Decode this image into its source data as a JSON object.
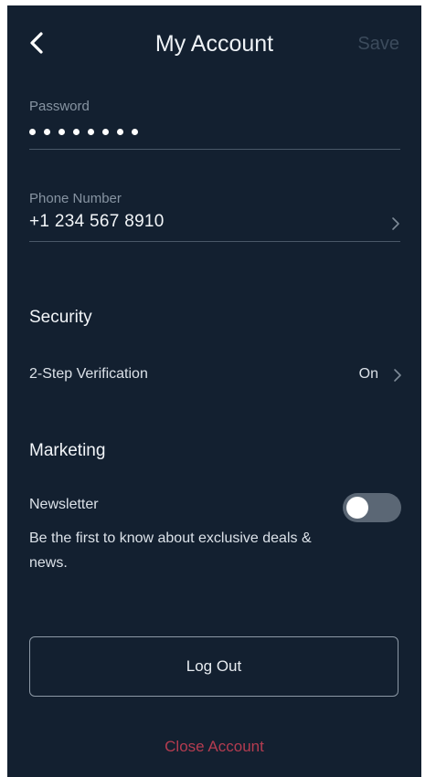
{
  "header": {
    "title": "My Account",
    "save_label": "Save",
    "back_icon": "chevron-left-icon"
  },
  "password": {
    "label": "Password",
    "dot_count": 8
  },
  "phone": {
    "label": "Phone Number",
    "value": "+1 234 567 8910"
  },
  "security": {
    "heading": "Security",
    "two_step": {
      "label": "2-Step Verification",
      "value": "On"
    }
  },
  "marketing": {
    "heading": "Marketing",
    "newsletter": {
      "label": "Newsletter",
      "description": "Be the first to know about exclusive deals & news.",
      "enabled": false
    }
  },
  "actions": {
    "logout_label": "Log Out",
    "close_account_label": "Close Account"
  },
  "colors": {
    "background": "#132030",
    "danger": "#b43c50",
    "muted": "#8794a2",
    "disabled": "#3c4b5c"
  }
}
